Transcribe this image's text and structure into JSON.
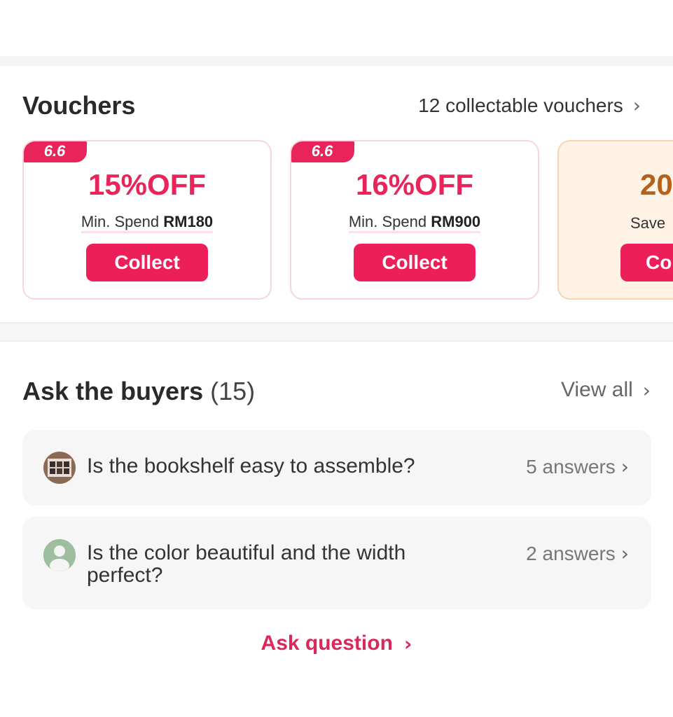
{
  "vouchers": {
    "title": "Vouchers",
    "collectable_link": "12 collectable vouchers",
    "cards": [
      {
        "tag": "6.6",
        "amount": "15%OFF",
        "min_label": "Min. Spend",
        "min_value": "RM180",
        "button": "Collect"
      },
      {
        "tag": "6.6",
        "amount": "16%OFF",
        "min_label": "Min. Spend",
        "min_value": "RM900",
        "button": "Collect"
      },
      {
        "amount": "20",
        "min_label": "Save",
        "button": "Co"
      }
    ]
  },
  "ask": {
    "title": "Ask the buyers",
    "count": "(15)",
    "view_all": "View all",
    "questions": [
      {
        "text": "Is the bookshelf easy to assemble?",
        "answers": "5 answers",
        "avatar": "product-photo-avatar"
      },
      {
        "text": "Is the color beautiful and the width perfect?",
        "answers": "2 answers",
        "avatar": "default-user-avatar"
      }
    ],
    "ask_question": "Ask question"
  },
  "colors": {
    "accent": "#ec1f5b",
    "accent_text": "#e8245a",
    "card_border": "#f7d6dd",
    "alt_card_bg": "#fff3e6",
    "alt_text": "#b5611b",
    "qa_bg": "#f6f6f6"
  },
  "icons": {
    "chevron": "chevron-right-icon"
  }
}
